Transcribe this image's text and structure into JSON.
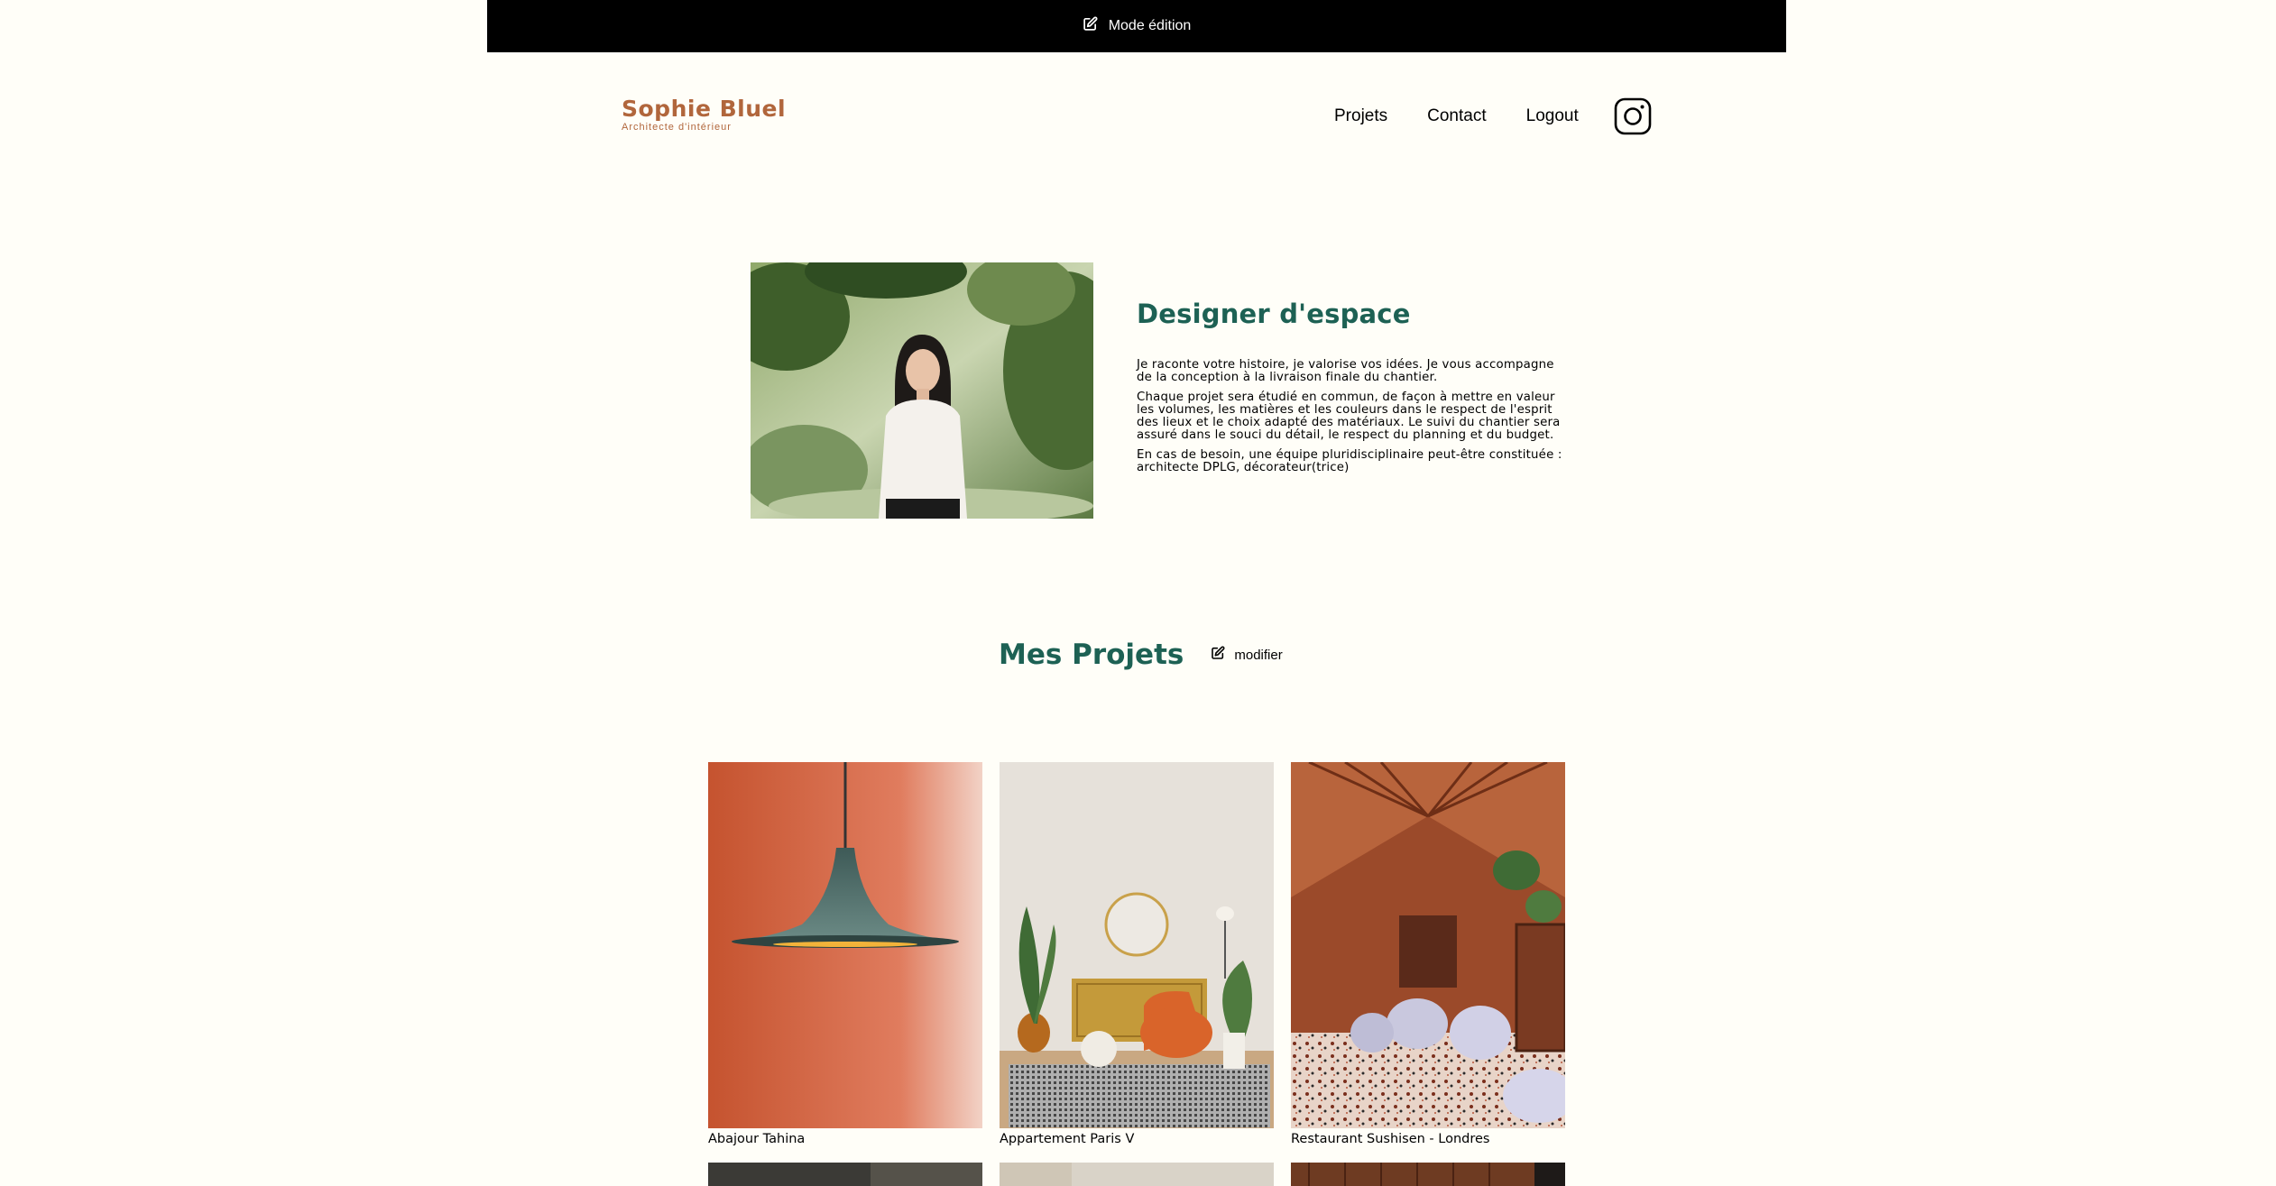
{
  "banner": {
    "label": "Mode édition",
    "icon": "edit-icon"
  },
  "header": {
    "logo_name": "Sophie Bluel",
    "logo_subtitle": "Architecte d'intérieur",
    "nav": [
      "Projets",
      "Contact",
      "Logout"
    ],
    "social_icon": "instagram-icon"
  },
  "introduction": {
    "title": "Designer d'espace",
    "paragraphs": [
      "Je raconte votre histoire, je valorise vos idées. Je vous accompagne de la conception à la livraison finale du chantier.",
      "Chaque projet sera étudié en commun, de façon à mettre en valeur les volumes, les matières et les couleurs dans le respect de l'esprit des lieux et le choix adapté des matériaux. Le suivi du chantier sera assuré dans le souci du détail, le respect du planning et du budget.",
      "En cas de besoin, une équipe pluridisciplinaire peut-être constituée : architecte DPLG, décorateur(trice)"
    ]
  },
  "portfolio": {
    "title": "Mes Projets",
    "modify_label": "modifier",
    "works": [
      {
        "caption": "Abajour Tahina"
      },
      {
        "caption": "Appartement Paris V"
      },
      {
        "caption": "Restaurant Sushisen - Londres"
      }
    ]
  },
  "colors": {
    "brand": "#B1663C",
    "title_green": "#1D6154",
    "background": "#FFFEF8",
    "banner": "#000000"
  }
}
